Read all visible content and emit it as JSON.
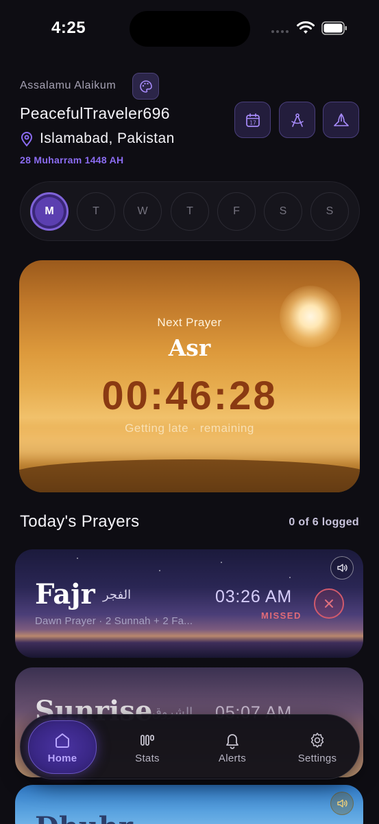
{
  "status_bar": {
    "time": "4:25"
  },
  "header": {
    "greeting": "Assalamu Alaikum",
    "username": "PeacefulTraveler696",
    "location": "Islamabad, Pakistan",
    "hijri_date": "28 Muharram 1448 AH",
    "buttons": [
      {
        "name": "calendar-button",
        "icon": "calendar-icon",
        "label": "17"
      },
      {
        "name": "qibla-compass-button",
        "icon": "compass-icon"
      },
      {
        "name": "prayer-mat-button",
        "icon": "mosque-icon"
      }
    ],
    "theme_icon": "palette-icon"
  },
  "week": {
    "days": [
      "M",
      "T",
      "W",
      "T",
      "F",
      "S",
      "S"
    ],
    "active_index": 0
  },
  "next_prayer": {
    "label": "Next Prayer",
    "name": "Asr",
    "countdown": "00:46:28",
    "subtitle": "Getting late · remaining"
  },
  "prayers_section": {
    "title": "Today's Prayers",
    "logged": "0 of 6 logged"
  },
  "prayers": [
    {
      "name": "Fajr",
      "arabic": "الفجر",
      "description": "Dawn Prayer · 2 Sunnah + 2 Fa...",
      "time": "03:26 AM",
      "status": "MISSED"
    },
    {
      "name": "Sunrise",
      "arabic": "الشروق",
      "time": "05:07 AM"
    },
    {
      "name": "Dhuhr"
    }
  ],
  "tabs": [
    {
      "label": "Home",
      "icon": "home-icon",
      "active": true
    },
    {
      "label": "Stats",
      "icon": "stats-icon",
      "active": false
    },
    {
      "label": "Alerts",
      "icon": "bell-icon",
      "active": false
    },
    {
      "label": "Settings",
      "icon": "gear-icon",
      "active": false
    }
  ],
  "colors": {
    "background": "#0e0d13",
    "accent": "#8b6cf2",
    "missed": "#e16b78",
    "countdown": "#8a3a12"
  }
}
